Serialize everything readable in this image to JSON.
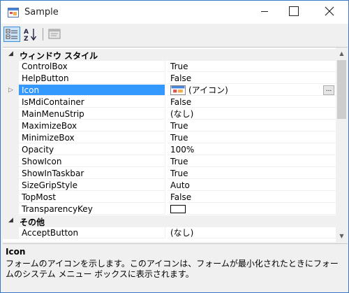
{
  "window": {
    "title": "Sample",
    "accent_color": "#3399ff"
  },
  "toolbar": {
    "buttons": [
      {
        "name": "categorized-view",
        "icon": "categorized-icon",
        "active": true
      },
      {
        "name": "alphabetical-view",
        "icon": "sort-az-icon",
        "label": "AZ"
      },
      {
        "name": "property-pages",
        "icon": "property-pages-icon"
      }
    ]
  },
  "grid": {
    "categories": {
      "window_style": "ウィンドウ スタイル",
      "other": "その他"
    },
    "rows": [
      {
        "name": "ControlBox",
        "value": "True"
      },
      {
        "name": "HelpButton",
        "value": "False"
      },
      {
        "name": "Icon",
        "value": "(アイコン)"
      },
      {
        "name": "IsMdiContainer",
        "value": "False"
      },
      {
        "name": "MainMenuStrip",
        "value": "(なし)"
      },
      {
        "name": "MaximizeBox",
        "value": "True"
      },
      {
        "name": "MinimizeBox",
        "value": "True"
      },
      {
        "name": "Opacity",
        "value": "100%"
      },
      {
        "name": "ShowIcon",
        "value": "True"
      },
      {
        "name": "ShowInTaskbar",
        "value": "True"
      },
      {
        "name": "SizeGripStyle",
        "value": "Auto"
      },
      {
        "name": "TopMost",
        "value": "False"
      },
      {
        "name": "TransparencyKey",
        "value": ""
      },
      {
        "name": "AcceptButton",
        "value": "(なし)"
      }
    ],
    "ellipsis_label": "..."
  },
  "description": {
    "title": "Icon",
    "text": "フォームのアイコンを示します。このアイコンは、フォームが最小化されたときにフォームのシステム メニュー ボックスに表示されます。"
  }
}
